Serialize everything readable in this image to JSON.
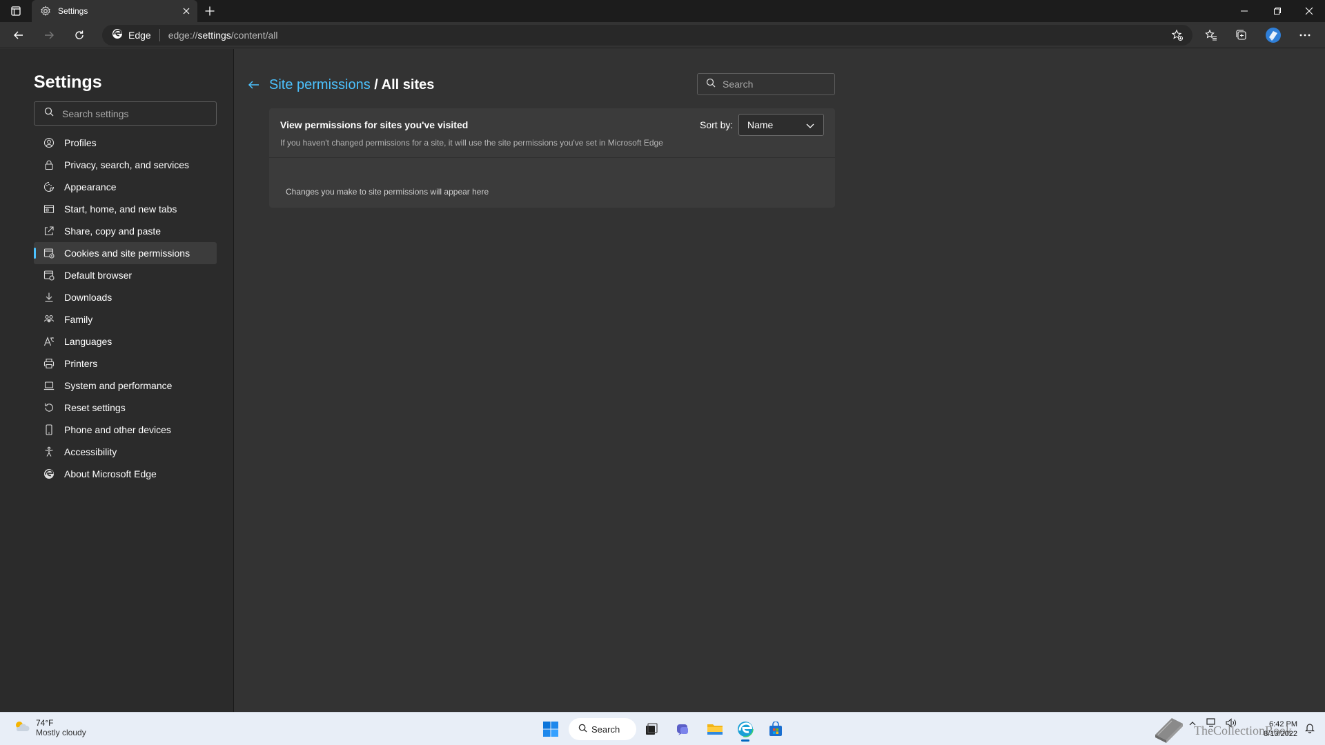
{
  "window": {
    "tab_title": "Settings",
    "tab_icon": "gear-icon"
  },
  "toolbar": {
    "edge_label": "Edge",
    "url_prefix": "edge://",
    "url_host": "settings",
    "url_path": "/content/all"
  },
  "sidebar": {
    "title": "Settings",
    "search_placeholder": "Search settings",
    "items": [
      {
        "label": "Profiles",
        "icon": "profile-icon"
      },
      {
        "label": "Privacy, search, and services",
        "icon": "lock-icon"
      },
      {
        "label": "Appearance",
        "icon": "appearance-icon"
      },
      {
        "label": "Start, home, and new tabs",
        "icon": "home-tabs-icon"
      },
      {
        "label": "Share, copy and paste",
        "icon": "share-icon"
      },
      {
        "label": "Cookies and site permissions",
        "icon": "cookies-icon",
        "active": true
      },
      {
        "label": "Default browser",
        "icon": "browser-icon"
      },
      {
        "label": "Downloads",
        "icon": "download-icon"
      },
      {
        "label": "Family",
        "icon": "family-icon"
      },
      {
        "label": "Languages",
        "icon": "language-icon"
      },
      {
        "label": "Printers",
        "icon": "printer-icon"
      },
      {
        "label": "System and performance",
        "icon": "laptop-icon"
      },
      {
        "label": "Reset settings",
        "icon": "reset-icon"
      },
      {
        "label": "Phone and other devices",
        "icon": "phone-icon"
      },
      {
        "label": "Accessibility",
        "icon": "accessibility-icon"
      },
      {
        "label": "About Microsoft Edge",
        "icon": "edge-icon"
      }
    ]
  },
  "main": {
    "breadcrumb_link": "Site permissions",
    "breadcrumb_sep": " / ",
    "breadcrumb_current": "All sites",
    "search_placeholder": "Search",
    "card": {
      "title": "View permissions for sites you've visited",
      "description": "If you haven't changed permissions for a site, it will use the site permissions you've set in Microsoft Edge",
      "sort_label": "Sort by:",
      "sort_value": "Name",
      "empty_text": "Changes you make to site permissions will appear here"
    }
  },
  "taskbar": {
    "weather_temp": "74°F",
    "weather_condition": "Mostly cloudy",
    "search_label": "Search",
    "time": "6:42 PM",
    "date": "8/13/2022",
    "watermark_text": "TheCollectionBook"
  },
  "colors": {
    "accent": "#4cc2ff",
    "background": "#333333",
    "sidebar": "#2b2b2b",
    "card": "#3b3b3b"
  }
}
